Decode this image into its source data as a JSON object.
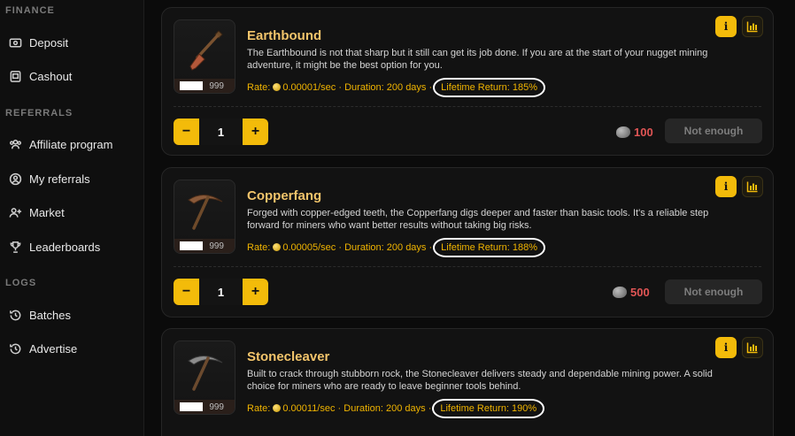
{
  "sidebar": {
    "sections": [
      {
        "title": "FINANCE",
        "items": [
          {
            "label": "Deposit",
            "icon": "deposit-icon"
          },
          {
            "label": "Cashout",
            "icon": "cashout-icon"
          }
        ]
      },
      {
        "title": "REFERRALS",
        "items": [
          {
            "label": "Affiliate program",
            "icon": "users-icon"
          },
          {
            "label": "My referrals",
            "icon": "user-circle-icon"
          },
          {
            "label": "Market",
            "icon": "user-plus-icon"
          },
          {
            "label": "Leaderboards",
            "icon": "trophy-icon"
          }
        ]
      },
      {
        "title": "LOGS",
        "items": [
          {
            "label": "Batches",
            "icon": "history-icon"
          },
          {
            "label": "Advertise",
            "icon": "history-icon"
          }
        ]
      }
    ]
  },
  "tools": [
    {
      "name": "Earthbound",
      "description": "The Earthbound is not that sharp but it still can get its job done. If you are at the start of your nugget mining adventure, it might be the best option for you.",
      "rate_prefix": "Rate:",
      "rate": "0.00001/sec",
      "duration": "Duration: 200 days",
      "lifetime": "Lifetime Return: 185%",
      "owned": "999",
      "quantity": "1",
      "price": "100",
      "button": "Not enough",
      "icon": "shovel-icon"
    },
    {
      "name": "Copperfang",
      "description": "Forged with copper-edged teeth, the Copperfang digs deeper and faster than basic tools. It's a reliable step forward for miners who want better results without taking big risks.",
      "rate_prefix": "Rate:",
      "rate": "0.00005/sec",
      "duration": "Duration: 200 days",
      "lifetime": "Lifetime Return: 188%",
      "owned": "999",
      "quantity": "1",
      "price": "500",
      "button": "Not enough",
      "icon": "pickaxe-icon"
    },
    {
      "name": "Stonecleaver",
      "description": "Built to crack through stubborn rock, the Stonecleaver delivers steady and dependable mining power. A solid choice for miners who are ready to leave beginner tools behind.",
      "rate_prefix": "Rate:",
      "rate": "0.00011/sec",
      "duration": "Duration: 200 days",
      "lifetime": "Lifetime Return: 190%",
      "owned": "999",
      "quantity": "1",
      "price": "",
      "button": "",
      "icon": "pickaxe-icon"
    }
  ],
  "controls": {
    "info_label": "i",
    "minus": "−",
    "plus": "+",
    "separator": "·"
  },
  "colors": {
    "accent": "#f3bb0a",
    "tool_name": "#f2c46b",
    "price_insufficient": "#e05555"
  }
}
